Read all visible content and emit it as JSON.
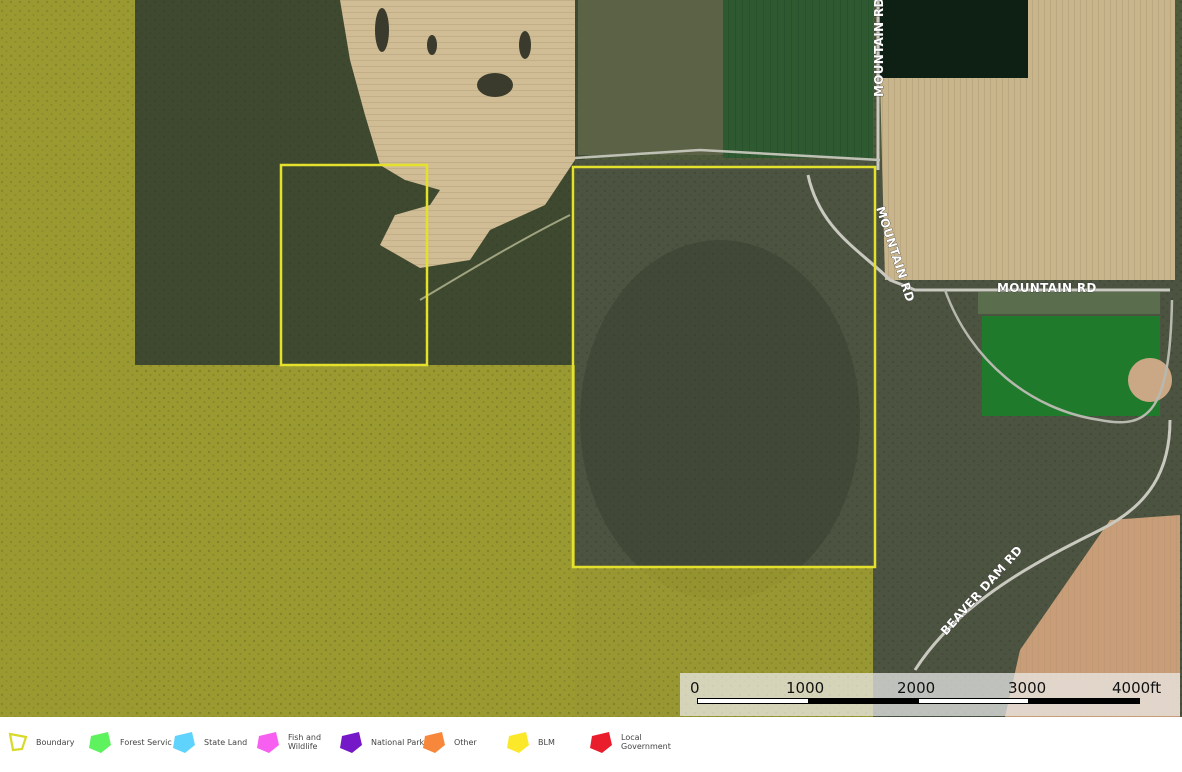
{
  "map": {
    "roads": [
      {
        "name": "MOUNTAIN RD"
      },
      {
        "name": "MOUNTAIN RD"
      },
      {
        "name": "MOUNTAIN RD"
      },
      {
        "name": "BEAVER DAM RD"
      }
    ]
  },
  "scale_bar": {
    "ticks": [
      "0",
      "1000",
      "2000",
      "3000",
      "4000ft"
    ]
  },
  "legend": {
    "items": [
      {
        "label": "Boundary",
        "color": "#d9d92a",
        "icon": "boundary-outline-icon"
      },
      {
        "label": "Forest Servic",
        "color": "#5ef25e",
        "icon": "forest-service-swatch-icon"
      },
      {
        "label": "State Land",
        "color": "#5fd3fb",
        "icon": "state-land-swatch-icon"
      },
      {
        "label": "Fish and Wildlife",
        "color": "#f75ff0",
        "icon": "fish-wildlife-swatch-icon"
      },
      {
        "label": "National Park",
        "color": "#7518c8",
        "icon": "national-park-swatch-icon"
      },
      {
        "label": "Other",
        "color": "#f7873a",
        "icon": "other-swatch-icon"
      },
      {
        "label": "BLM",
        "color": "#fbe82b",
        "icon": "blm-swatch-icon"
      },
      {
        "label": "Local Government",
        "color": "#ea1d2c",
        "icon": "local-government-swatch-icon"
      }
    ]
  }
}
